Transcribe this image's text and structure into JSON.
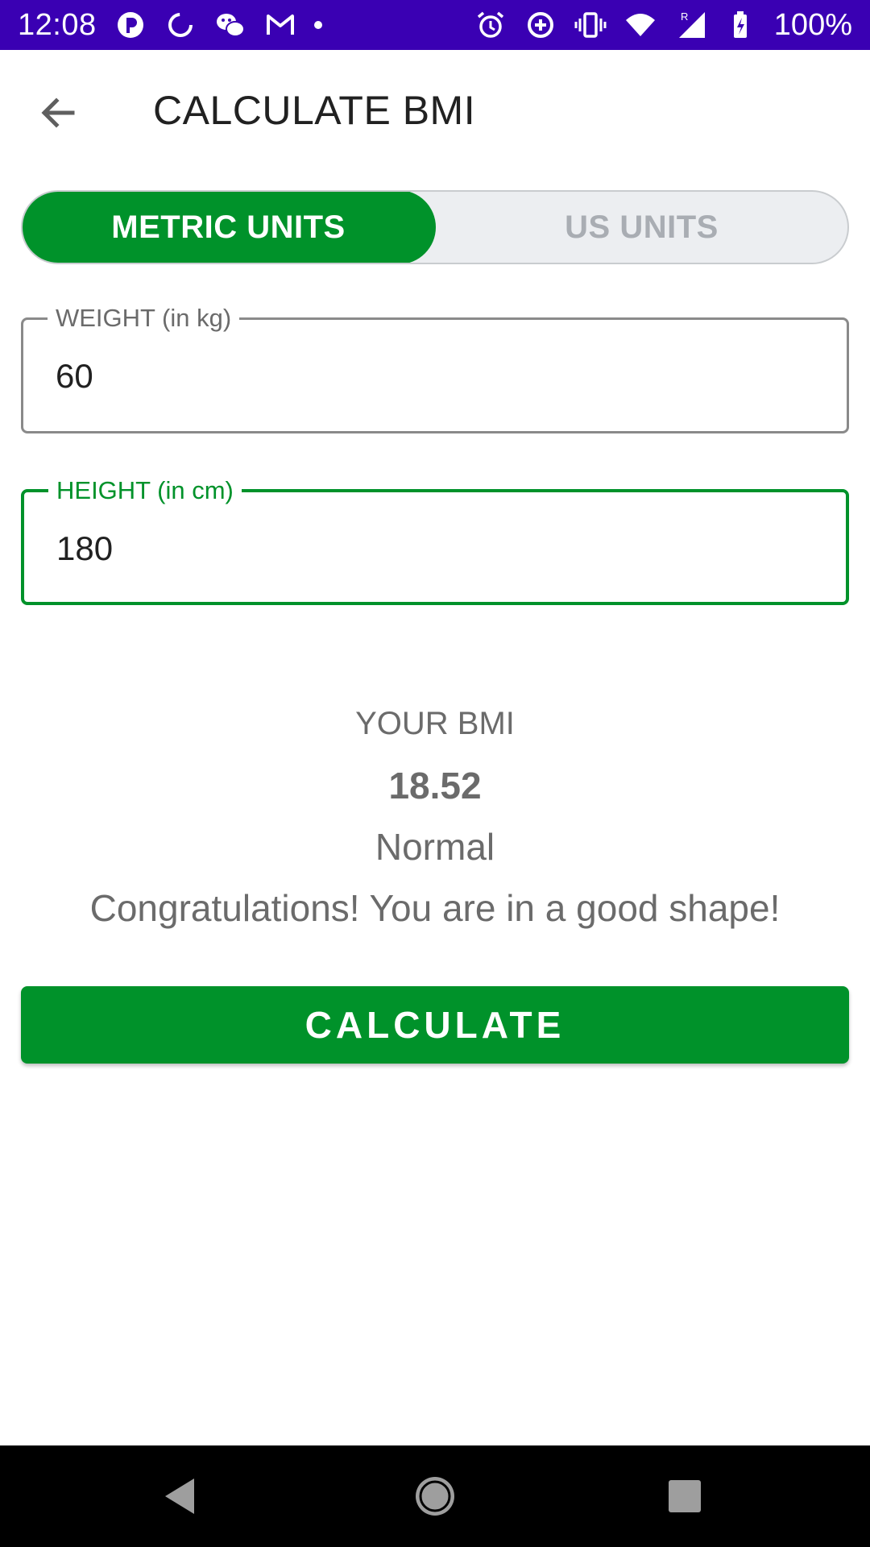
{
  "status_bar": {
    "time": "12:08",
    "battery": "100%",
    "left_icons": [
      "p-app-icon",
      "sync-icon",
      "wechat-icon",
      "gmail-icon",
      "dot-icon"
    ],
    "right_icons": [
      "alarm-icon",
      "data-saver-icon",
      "vibrate-icon",
      "wifi-icon",
      "signal-roaming-icon",
      "battery-charging-icon"
    ],
    "background": "#3a00b3"
  },
  "app_bar": {
    "title": "CALCULATE BMI",
    "back_icon": "arrow-back-icon"
  },
  "unit_toggle": {
    "metric_label": "METRIC UNITS",
    "us_label": "US UNITS",
    "selected": "METRIC UNITS"
  },
  "form": {
    "weight_label": "WEIGHT (in kg)",
    "weight_value": "60",
    "height_label": "HEIGHT (in cm)",
    "height_value": "180"
  },
  "result": {
    "label": "YOUR BMI",
    "value": "18.52",
    "category": "Normal",
    "message": "Congratulations! You are in a good shape!"
  },
  "actions": {
    "calculate_label": "CALCULATE"
  },
  "colors": {
    "accent": "#00922a",
    "toggle_inactive_bg": "#eceef1",
    "toggle_inactive_text": "#a9adb3",
    "text_secondary": "#6b6b6b"
  },
  "nav_bar": {
    "icons": [
      "nav-back-icon",
      "nav-home-icon",
      "nav-recents-icon"
    ]
  }
}
